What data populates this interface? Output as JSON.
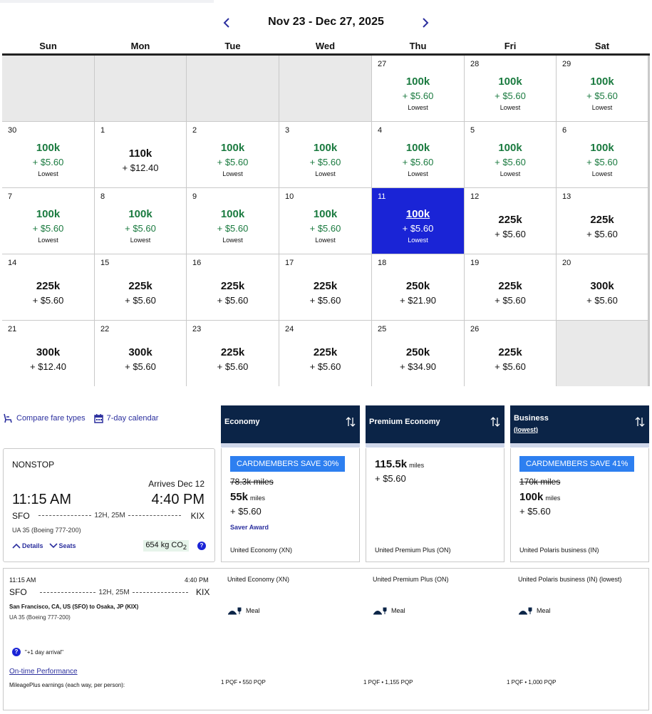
{
  "calendar": {
    "range_title": "Nov 23 - Dec 27, 2025",
    "weekdays": [
      "Sun",
      "Mon",
      "Tue",
      "Wed",
      "Thu",
      "Fri",
      "Sat"
    ],
    "lowest_label": "Lowest",
    "colors": {
      "lowest": "#1a7a3f",
      "selected": "#1a24d6",
      "empty": "#e9e9e9"
    },
    "days": [
      {
        "day": "27",
        "points": "100k",
        "cash": "+ $5.60",
        "lowest": true
      },
      {
        "day": "28",
        "points": "100k",
        "cash": "+ $5.60",
        "lowest": true
      },
      {
        "day": "29",
        "points": "100k",
        "cash": "+ $5.60",
        "lowest": true
      },
      {
        "day": "30",
        "points": "100k",
        "cash": "+ $5.60",
        "lowest": true
      },
      {
        "day": "1",
        "points": "110k",
        "cash": "+ $12.40",
        "lowest": false
      },
      {
        "day": "2",
        "points": "100k",
        "cash": "+ $5.60",
        "lowest": true
      },
      {
        "day": "3",
        "points": "100k",
        "cash": "+ $5.60",
        "lowest": true
      },
      {
        "day": "4",
        "points": "100k",
        "cash": "+ $5.60",
        "lowest": true
      },
      {
        "day": "5",
        "points": "100k",
        "cash": "+ $5.60",
        "lowest": true
      },
      {
        "day": "6",
        "points": "100k",
        "cash": "+ $5.60",
        "lowest": true
      },
      {
        "day": "7",
        "points": "100k",
        "cash": "+ $5.60",
        "lowest": true
      },
      {
        "day": "8",
        "points": "100k",
        "cash": "+ $5.60",
        "lowest": true
      },
      {
        "day": "9",
        "points": "100k",
        "cash": "+ $5.60",
        "lowest": true
      },
      {
        "day": "10",
        "points": "100k",
        "cash": "+ $5.60",
        "lowest": true
      },
      {
        "day": "11",
        "points": "100k",
        "cash": "+ $5.60",
        "lowest": true,
        "selected": true
      },
      {
        "day": "12",
        "points": "225k",
        "cash": "+ $5.60",
        "lowest": false
      },
      {
        "day": "13",
        "points": "225k",
        "cash": "+ $5.60",
        "lowest": false
      },
      {
        "day": "14",
        "points": "225k",
        "cash": "+ $5.60",
        "lowest": false
      },
      {
        "day": "15",
        "points": "225k",
        "cash": "+ $5.60",
        "lowest": false
      },
      {
        "day": "16",
        "points": "225k",
        "cash": "+ $5.60",
        "lowest": false
      },
      {
        "day": "17",
        "points": "225k",
        "cash": "+ $5.60",
        "lowest": false
      },
      {
        "day": "18",
        "points": "250k",
        "cash": "+ $21.90",
        "lowest": false
      },
      {
        "day": "19",
        "points": "225k",
        "cash": "+ $5.60",
        "lowest": false
      },
      {
        "day": "20",
        "points": "300k",
        "cash": "+ $5.60",
        "lowest": false
      },
      {
        "day": "21",
        "points": "300k",
        "cash": "+ $12.40",
        "lowest": false
      },
      {
        "day": "22",
        "points": "300k",
        "cash": "+ $5.60",
        "lowest": false
      },
      {
        "day": "23",
        "points": "225k",
        "cash": "+ $5.60",
        "lowest": false
      },
      {
        "day": "24",
        "points": "225k",
        "cash": "+ $5.60",
        "lowest": false
      },
      {
        "day": "25",
        "points": "250k",
        "cash": "+ $34.90",
        "lowest": false
      },
      {
        "day": "26",
        "points": "225k",
        "cash": "+ $5.60",
        "lowest": false
      }
    ]
  },
  "toolbar": {
    "compare_label": "Compare fare types",
    "calendar_label": "7-day calendar"
  },
  "columns": {
    "economy": "Economy",
    "premium": "Premium Economy",
    "business": "Business",
    "business_sub": "(lowest)"
  },
  "flight": {
    "stops": "NONSTOP",
    "arrives_label": "Arrives Dec 12",
    "depart_time": "11:15 AM",
    "arrive_time": "4:40 PM",
    "origin": "SFO",
    "destination": "KIX",
    "duration": "12H, 25M",
    "flight_info": "UA 35 (Boeing 777-200)",
    "details_label": "Details",
    "seats_label": "Seats",
    "co2_value": "654 kg CO",
    "co2_sub": "2"
  },
  "fares": {
    "economy": {
      "badge": "CARDMEMBERS SAVE 30%",
      "original": "78.3k miles",
      "miles": "55k",
      "miles_unit": "miles",
      "cash": "+ $5.60",
      "saver": "Saver Award",
      "product": "United Economy (XN)"
    },
    "premium": {
      "miles": "115.5k",
      "miles_unit": "miles",
      "cash": "+ $5.60",
      "product": "United Premium Plus (ON)"
    },
    "business": {
      "badge": "CARDMEMBERS SAVE 41%",
      "original": "170k miles",
      "miles": "100k",
      "miles_unit": "miles",
      "cash": "+ $5.60",
      "product": "United Polaris business (IN)"
    }
  },
  "details": {
    "depart_time": "11:15 AM",
    "arrive_time": "4:40 PM",
    "origin": "SFO",
    "destination": "KIX",
    "duration": "12H, 25M",
    "route": "San Francisco, CA, US (SFO) to Osaka, JP (KIX)",
    "flight_info": "UA 35 (Boeing 777-200)",
    "arrival_note": "\"+1 day arrival\"",
    "ontime_label": "On-time Performance",
    "earnings_label": "MileagePlus earnings (each way, per person):",
    "meal_label": "Meal",
    "economy_name": "United Economy (XN)",
    "premium_name": "United Premium Plus (ON)",
    "business_name": "United Polaris business (IN) (lowest)",
    "economy_pqp": "1 PQF • 550 PQP",
    "premium_pqp": "1 PQF • 1,155 PQP",
    "business_pqp": "1 PQF • 1,000 PQP"
  }
}
